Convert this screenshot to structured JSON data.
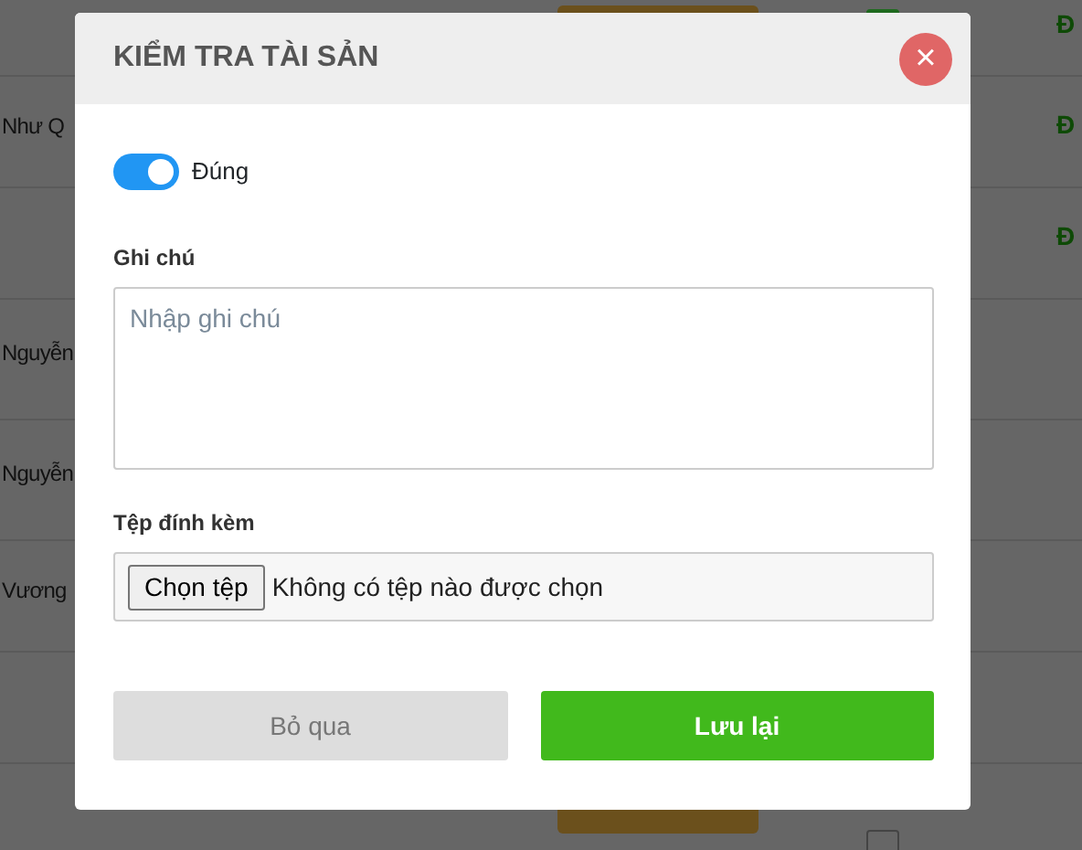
{
  "background_table": {
    "rows": [
      {
        "has_badge": true,
        "checked": true,
        "status": "Đ"
      },
      {
        "name": "Như Q",
        "status": "Đ"
      },
      {
        "status": "Đ"
      },
      {
        "name": "Nguyễn"
      },
      {
        "name": "Nguyễn"
      },
      {
        "name": "Vương"
      },
      {},
      {
        "has_badge": true,
        "checked": false
      }
    ]
  },
  "dialog": {
    "title": "KIỂM TRA TÀI SẢN",
    "close": "×",
    "switch": {
      "label": "Đúng",
      "on": true
    },
    "note": {
      "label": "Ghi chú",
      "placeholder": "Nhập ghi chú"
    },
    "attachment": {
      "label": "Tệp đính kèm",
      "button": "Chọn tệp",
      "status": "Không có tệp nào được chọn"
    },
    "buttons": [
      {
        "label": "Bỏ qua",
        "kind": "secondary"
      },
      {
        "label": "Lưu lại",
        "kind": "primary"
      }
    ]
  }
}
